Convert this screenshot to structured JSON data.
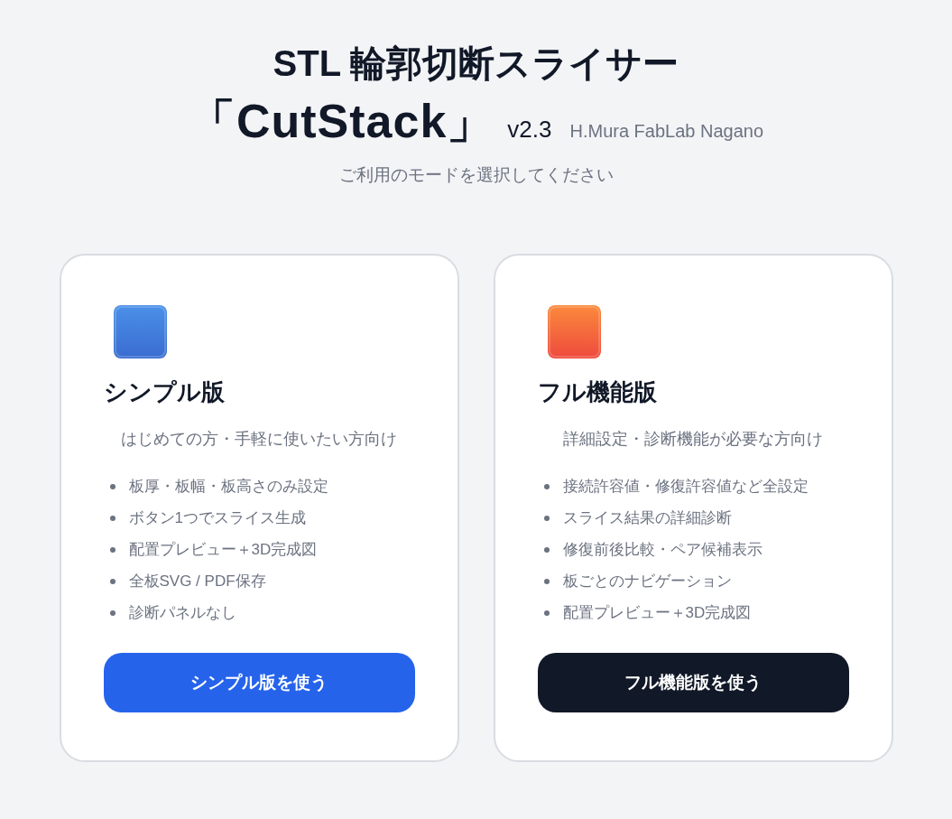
{
  "header": {
    "title": "STL 輪郭切断スライサー",
    "app_name": "「CutStack」",
    "version": "v2.3",
    "author": "H.Mura FabLab Nagano",
    "subtitle": "ご利用のモードを選択してください"
  },
  "cards": [
    {
      "kind": "simple",
      "title": "シンプル版",
      "description": "はじめての方・手軽に使いたい方向け",
      "features": [
        "板厚・板幅・板高さのみ設定",
        "ボタン1つでスライス生成",
        "配置プレビュー＋3D完成図",
        "全板SVG / PDF保存",
        "診断パネルなし"
      ],
      "button": "シンプル版を使う"
    },
    {
      "kind": "full",
      "title": "フル機能版",
      "description": "詳細設定・診断機能が必要な方向け",
      "features": [
        "接続許容値・修復許容値など全設定",
        "スライス結果の詳細診断",
        "修復前後比較・ペア候補表示",
        "板ごとのナビゲーション",
        "配置プレビュー＋3D完成図"
      ],
      "button": "フル機能版を使う"
    }
  ]
}
